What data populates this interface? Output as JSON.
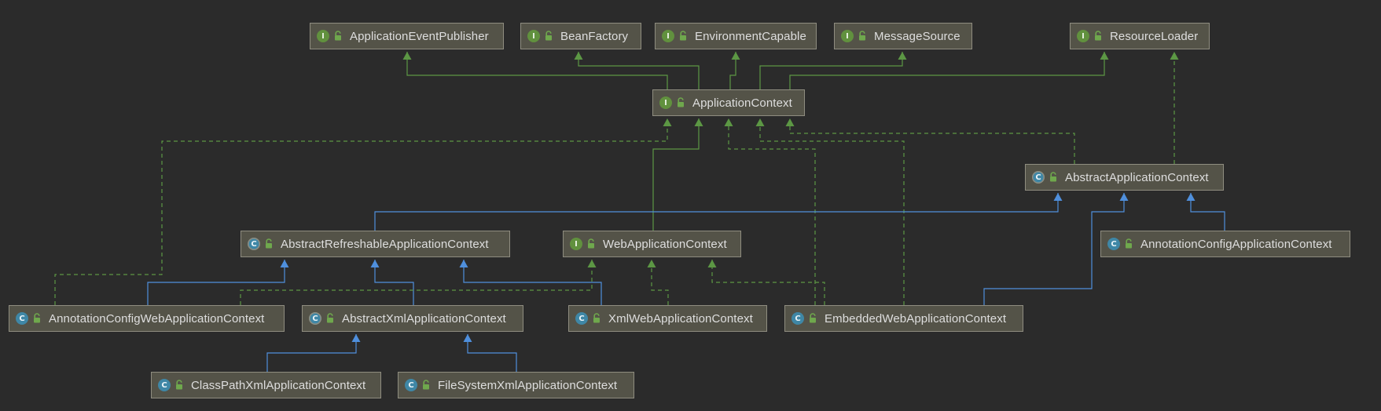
{
  "diagram": {
    "nodes": [
      {
        "id": "ApplicationEventPublisher",
        "label": "ApplicationEventPublisher",
        "kind": "interface"
      },
      {
        "id": "BeanFactory",
        "label": "BeanFactory",
        "kind": "interface"
      },
      {
        "id": "EnvironmentCapable",
        "label": "EnvironmentCapable",
        "kind": "interface"
      },
      {
        "id": "MessageSource",
        "label": "MessageSource",
        "kind": "interface"
      },
      {
        "id": "ResourceLoader",
        "label": "ResourceLoader",
        "kind": "interface"
      },
      {
        "id": "ApplicationContext",
        "label": "ApplicationContext",
        "kind": "interface"
      },
      {
        "id": "AbstractApplicationContext",
        "label": "AbstractApplicationContext",
        "kind": "abstract"
      },
      {
        "id": "AbstractRefreshableApplicationContext",
        "label": "AbstractRefreshableApplicationContext",
        "kind": "abstract"
      },
      {
        "id": "WebApplicationContext",
        "label": "WebApplicationContext",
        "kind": "interface"
      },
      {
        "id": "AnnotationConfigApplicationContext",
        "label": "AnnotationConfigApplicationContext",
        "kind": "class"
      },
      {
        "id": "AnnotationConfigWebApplicationContext",
        "label": "AnnotationConfigWebApplicationContext",
        "kind": "class"
      },
      {
        "id": "AbstractXmlApplicationContext",
        "label": "AbstractXmlApplicationContext",
        "kind": "abstract"
      },
      {
        "id": "XmlWebApplicationContext",
        "label": "XmlWebApplicationContext",
        "kind": "class"
      },
      {
        "id": "EmbeddedWebApplicationContext",
        "label": "EmbeddedWebApplicationContext",
        "kind": "class"
      },
      {
        "id": "ClassPathXmlApplicationContext",
        "label": "ClassPathXmlApplicationContext",
        "kind": "class"
      },
      {
        "id": "FileSystemXmlApplicationContext",
        "label": "FileSystemXmlApplicationContext",
        "kind": "class"
      }
    ],
    "edges": [
      {
        "from": "ApplicationContext",
        "to": "ApplicationEventPublisher",
        "type": "extends"
      },
      {
        "from": "ApplicationContext",
        "to": "BeanFactory",
        "type": "extends"
      },
      {
        "from": "ApplicationContext",
        "to": "EnvironmentCapable",
        "type": "extends"
      },
      {
        "from": "ApplicationContext",
        "to": "MessageSource",
        "type": "extends"
      },
      {
        "from": "ApplicationContext",
        "to": "ResourceLoader",
        "type": "extends"
      },
      {
        "from": "WebApplicationContext",
        "to": "ApplicationContext",
        "type": "extends"
      },
      {
        "from": "AbstractApplicationContext",
        "to": "ResourceLoader",
        "type": "implements"
      },
      {
        "from": "AbstractApplicationContext",
        "to": "ApplicationContext",
        "type": "implements"
      },
      {
        "from": "AnnotationConfigWebApplicationContext",
        "to": "ApplicationContext",
        "type": "implements"
      },
      {
        "from": "XmlWebApplicationContext",
        "to": "ApplicationContext",
        "type": "implements"
      },
      {
        "from": "EmbeddedWebApplicationContext",
        "to": "ApplicationContext",
        "type": "implements"
      },
      {
        "from": "AbstractRefreshableApplicationContext",
        "to": "AbstractApplicationContext",
        "type": "extends-class"
      },
      {
        "from": "EmbeddedWebApplicationContext",
        "to": "AbstractApplicationContext",
        "type": "extends-class"
      },
      {
        "from": "AnnotationConfigApplicationContext",
        "to": "AbstractApplicationContext",
        "type": "extends-class"
      },
      {
        "from": "AnnotationConfigWebApplicationContext",
        "to": "AbstractRefreshableApplicationContext",
        "type": "extends-class"
      },
      {
        "from": "AbstractXmlApplicationContext",
        "to": "AbstractRefreshableApplicationContext",
        "type": "extends-class"
      },
      {
        "from": "XmlWebApplicationContext",
        "to": "AbstractRefreshableApplicationContext",
        "type": "extends-class"
      },
      {
        "from": "AnnotationConfigWebApplicationContext",
        "to": "WebApplicationContext",
        "type": "implements"
      },
      {
        "from": "XmlWebApplicationContext",
        "to": "WebApplicationContext",
        "type": "implements"
      },
      {
        "from": "EmbeddedWebApplicationContext",
        "to": "WebApplicationContext",
        "type": "implements"
      },
      {
        "from": "ClassPathXmlApplicationContext",
        "to": "AbstractXmlApplicationContext",
        "type": "extends-class"
      },
      {
        "from": "FileSystemXmlApplicationContext",
        "to": "AbstractXmlApplicationContext",
        "type": "extends-class"
      }
    ],
    "colors": {
      "background": "#2b2b2b",
      "node_fill": "#545348",
      "node_border": "#8f8d80",
      "node_text": "#dedede",
      "interface_badge": "#61913e",
      "class_badge": "#3f87a6",
      "interface_edge": "#5c9744",
      "class_edge": "#4f8fdc",
      "lock": "#6fa84d"
    },
    "badge_glyphs": {
      "interface": "I",
      "class": "C",
      "abstract": "C"
    }
  }
}
